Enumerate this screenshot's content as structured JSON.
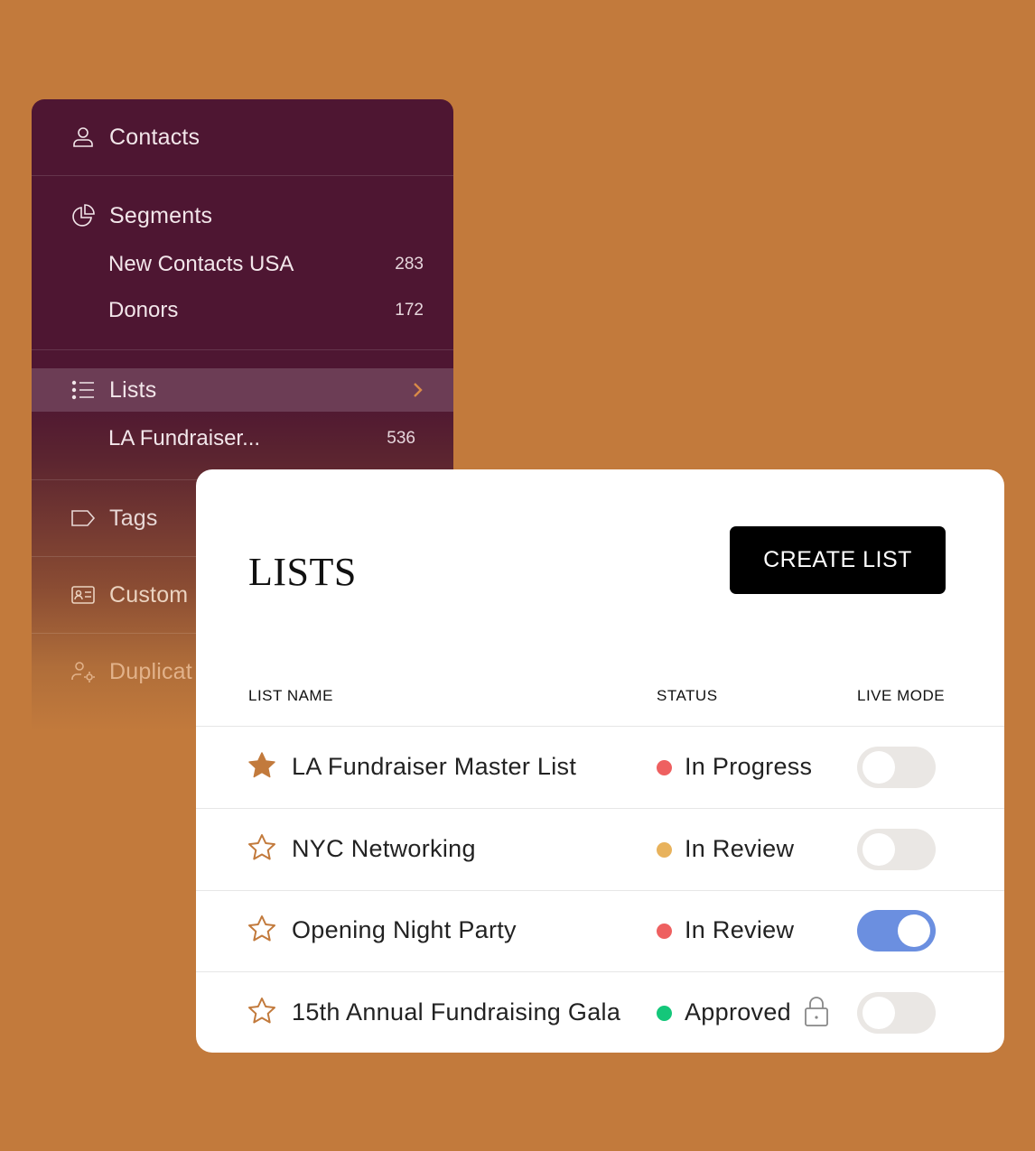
{
  "sidebar": {
    "contacts": {
      "label": "Contacts"
    },
    "segments": {
      "label": "Segments",
      "items": [
        {
          "label": "New Contacts USA",
          "count": "283"
        },
        {
          "label": "Donors",
          "count": "172"
        }
      ]
    },
    "lists": {
      "label": "Lists",
      "items": [
        {
          "label": "LA Fundraiser...",
          "count": "536"
        }
      ]
    },
    "tags": {
      "label": "Tags"
    },
    "custom": {
      "label": "Custom"
    },
    "duplicates": {
      "label": "Duplicat"
    }
  },
  "card": {
    "title": "LISTS",
    "create_button": "CREATE LIST",
    "columns": {
      "name": "LIST NAME",
      "status": "STATUS",
      "live": "LIVE MODE"
    },
    "rows": [
      {
        "name": "LA Fundraiser Master List",
        "status": "In Progress",
        "status_color": "#EE6060",
        "starred": true,
        "live": false,
        "locked": false
      },
      {
        "name": "NYC Networking",
        "status": "In Review",
        "status_color": "#E8B25C",
        "starred": false,
        "live": false,
        "locked": false
      },
      {
        "name": "Opening Night Party",
        "status": "In Review",
        "status_color": "#EE6060",
        "starred": false,
        "live": true,
        "locked": false
      },
      {
        "name": "15th Annual Fundraising Gala",
        "status": "Approved",
        "status_color": "#14C77A",
        "starred": false,
        "live": false,
        "locked": true
      }
    ]
  },
  "colors": {
    "background": "#C27A3C",
    "sidebar": "#4E1632",
    "active_item": "#6C3D55",
    "star": "#C27A3C",
    "toggle_on": "#6B8FE0",
    "toggle_off": "#EAE7E4"
  }
}
